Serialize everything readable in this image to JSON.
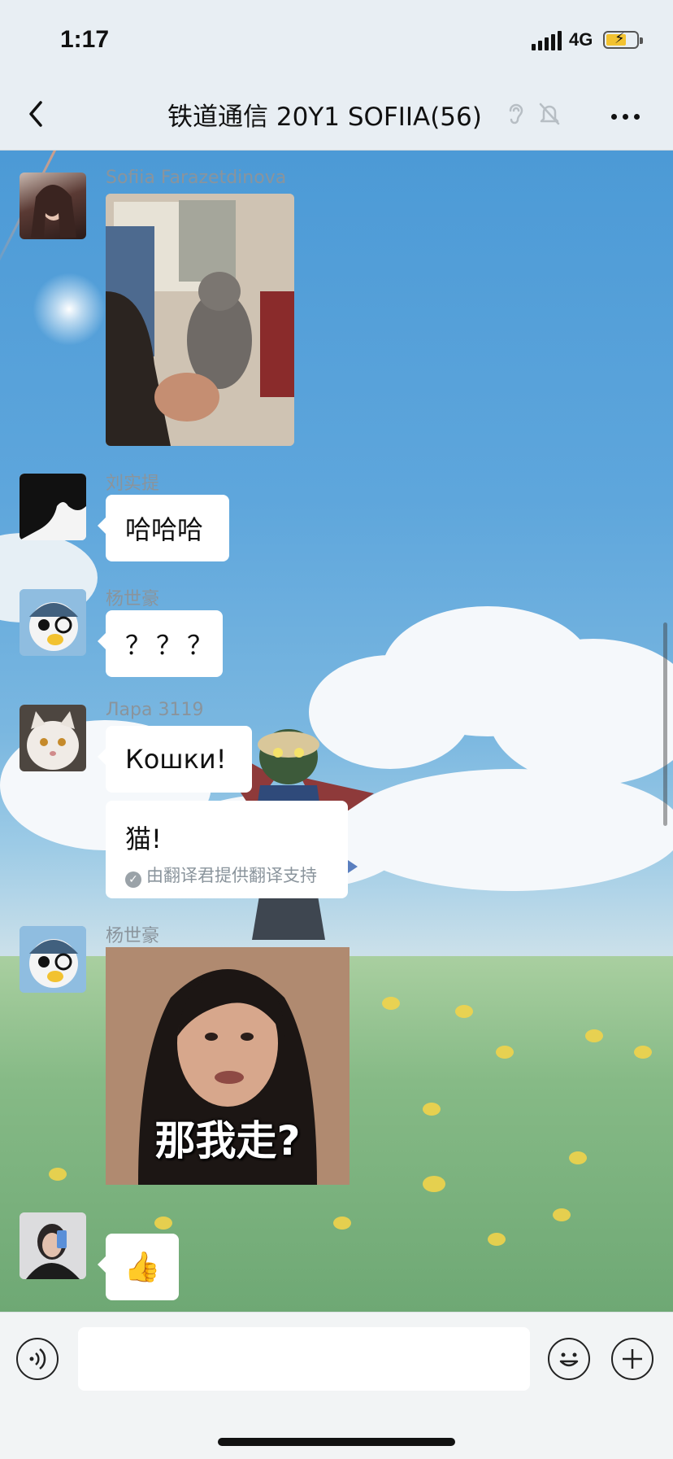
{
  "status_bar": {
    "time": "1:17",
    "network": "4G"
  },
  "nav": {
    "title": "铁道通信 20Y1  SOFIIA(56)",
    "icons": [
      "back-icon",
      "ear-icon",
      "mute-bell-icon",
      "more-icon"
    ]
  },
  "messages": [
    {
      "sender": "Sofiia Farazetdinova",
      "type": "image",
      "content": "cat photo"
    },
    {
      "sender": "刘实提",
      "type": "text",
      "text": "哈哈哈"
    },
    {
      "sender": "杨世豪",
      "type": "text",
      "text": "？？？"
    },
    {
      "sender": "Лара 3119",
      "type": "text",
      "text": "Кошки!",
      "translation": {
        "text": "猫!",
        "note": "由翻译君提供翻译支持"
      }
    },
    {
      "sender": "杨世豪",
      "type": "image",
      "caption": "那我走?"
    },
    {
      "sender": "",
      "type": "emoji",
      "text": "👍"
    }
  ],
  "input_bar": {
    "placeholder": "",
    "icons": [
      "voice-icon",
      "emoji-icon",
      "plus-icon"
    ]
  },
  "colors": {
    "bubble": "#ffffff",
    "sender_text": "#8a949c",
    "sky": "#5ea6dc",
    "grass": "#86ba86"
  }
}
